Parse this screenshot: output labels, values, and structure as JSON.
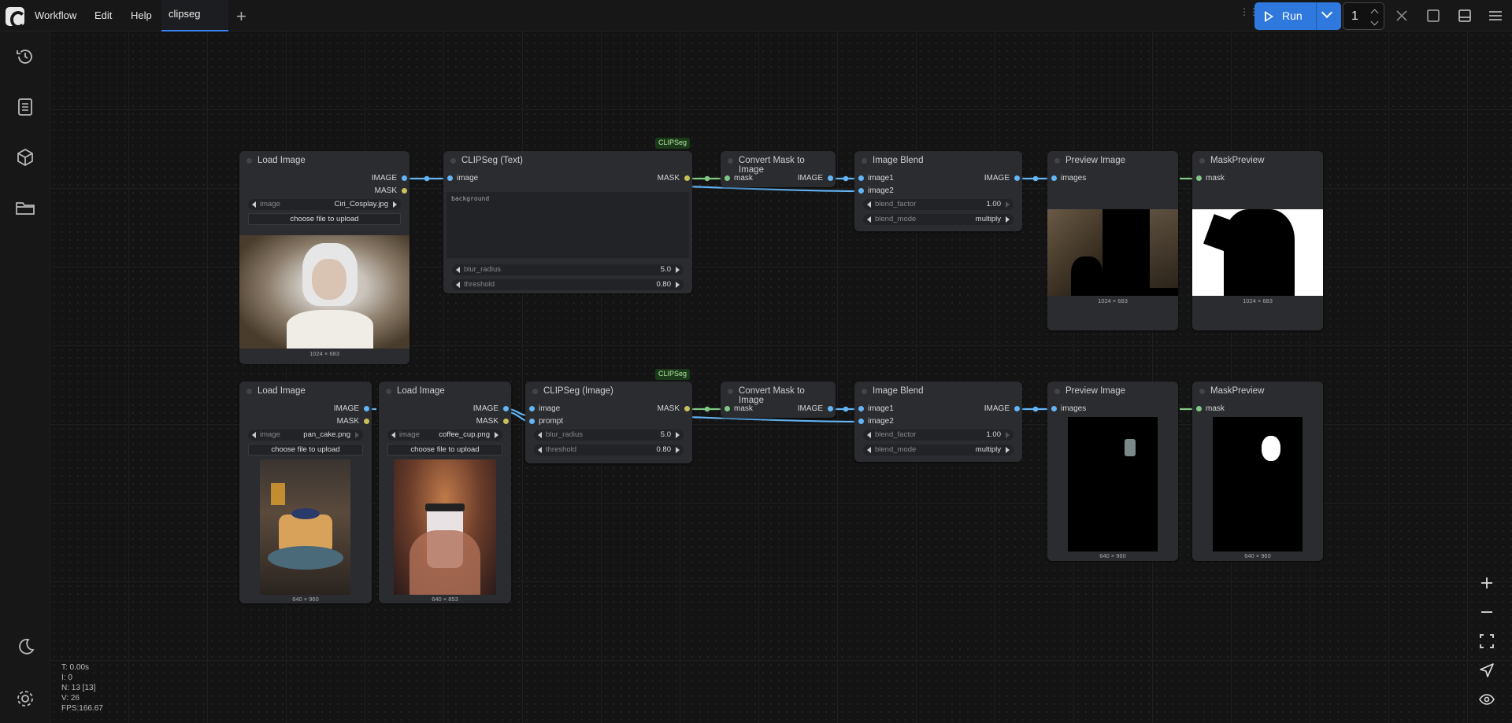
{
  "menu": {
    "workflow": "Workflow",
    "edit": "Edit",
    "help": "Help"
  },
  "tab": {
    "label": "clipseg"
  },
  "run": {
    "label": "Run",
    "queue_count": "1"
  },
  "badges": [
    "CLIPSeg",
    "CLIPSeg"
  ],
  "nodes": {
    "load1": {
      "title": "Load Image",
      "out_image": "IMAGE",
      "out_mask": "MASK",
      "w_name": "image",
      "w_val": "Ciri_Cosplay.jpg",
      "upload": "choose file to upload",
      "dim": "1024 × 683"
    },
    "clip_text": {
      "title": "CLIPSeg (Text)",
      "in_image": "image",
      "out_mask": "MASK",
      "text": "background",
      "blur_name": "blur_radius",
      "blur_val": "5.0",
      "thr_name": "threshold",
      "thr_val": "0.80"
    },
    "conv1": {
      "title": "Convert Mask to Image",
      "in_mask": "mask",
      "out_image": "IMAGE"
    },
    "blend1": {
      "title": "Image Blend",
      "in1": "image1",
      "in2": "image2",
      "out": "IMAGE",
      "bf_name": "blend_factor",
      "bf_val": "1.00",
      "bm_name": "blend_mode",
      "bm_val": "multiply"
    },
    "prev1": {
      "title": "Preview Image",
      "in": "images",
      "dim": "1024 × 683"
    },
    "mprev1": {
      "title": "MaskPreview",
      "in": "mask",
      "dim": "1024 × 683"
    },
    "load2": {
      "title": "Load Image",
      "out_image": "IMAGE",
      "out_mask": "MASK",
      "w_name": "image",
      "w_val": "pan_cake.png",
      "upload": "choose file to upload",
      "dim": "640 × 960"
    },
    "load3": {
      "title": "Load Image",
      "out_image": "IMAGE",
      "out_mask": "MASK",
      "w_name": "image",
      "w_val": "coffee_cup.png",
      "upload": "choose file to upload",
      "dim": "640 × 853"
    },
    "clip_img": {
      "title": "CLIPSeg (Image)",
      "in_image": "image",
      "in_prompt": "prompt",
      "out_mask": "MASK",
      "blur_name": "blur_radius",
      "blur_val": "5.0",
      "thr_name": "threshold",
      "thr_val": "0.80"
    },
    "conv2": {
      "title": "Convert Mask to Image",
      "in_mask": "mask",
      "out_image": "IMAGE"
    },
    "blend2": {
      "title": "Image Blend",
      "in1": "image1",
      "in2": "image2",
      "out": "IMAGE",
      "bf_name": "blend_factor",
      "bf_val": "1.00",
      "bm_name": "blend_mode",
      "bm_val": "multiply"
    },
    "prev2": {
      "title": "Preview Image",
      "in": "images",
      "dim": "640 × 960"
    },
    "mprev2": {
      "title": "MaskPreview",
      "in": "mask",
      "dim": "640 × 960"
    }
  },
  "stats": {
    "t": "T: 0.00s",
    "i": "I: 0",
    "n": "N: 13 [13]",
    "v": "V: 26",
    "fps": "FPS:166.67"
  },
  "colors": {
    "accent": "#2f79de",
    "image_link": "#64b5f6",
    "mask_link": "#81c784",
    "canvas": "#141414",
    "node": "#2a2c30"
  },
  "icons": [
    "history-icon",
    "queue-list-icon",
    "model-cube-icon",
    "workflow-folder-icon",
    "theme-moon-icon",
    "settings-gear-icon",
    "zoom-in-icon",
    "zoom-out-icon",
    "fit-view-icon",
    "select-mode-icon",
    "toggle-links-icon",
    "close-icon",
    "focus-mode-icon",
    "bottom-panel-icon",
    "hamburger-menu-icon"
  ]
}
